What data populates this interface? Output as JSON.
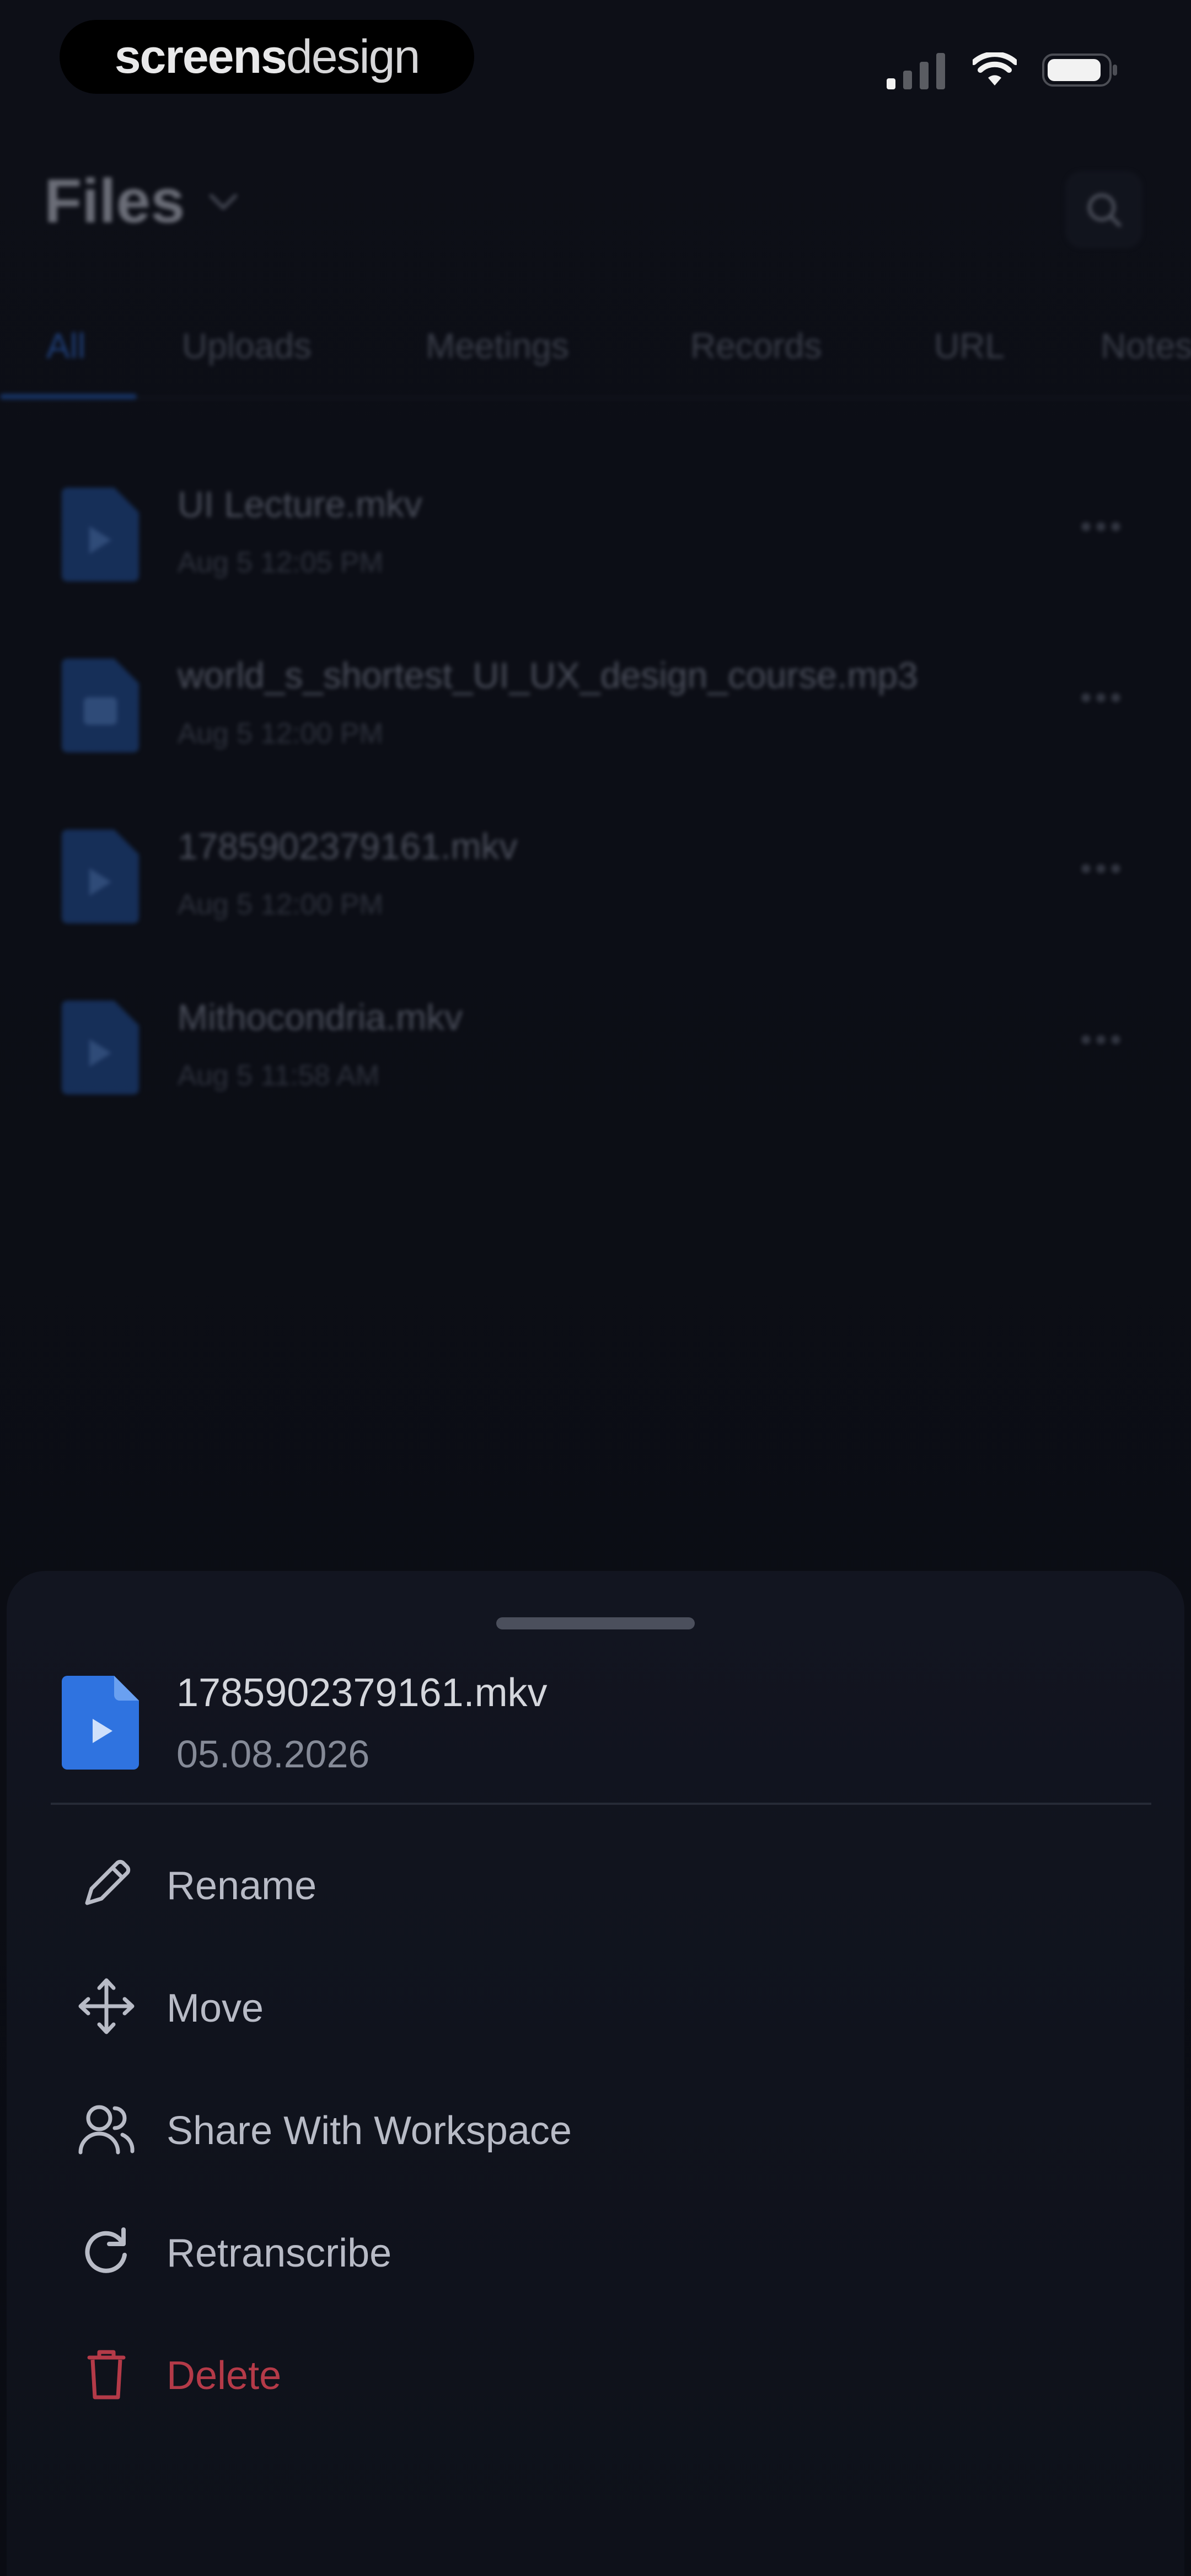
{
  "status_bar": {
    "brand_bold": "screens",
    "brand_light": "design"
  },
  "header": {
    "title": "Files"
  },
  "tabs": [
    {
      "label": "All",
      "active": true
    },
    {
      "label": "Uploads",
      "active": false
    },
    {
      "label": "Meetings",
      "active": false
    },
    {
      "label": "Records",
      "active": false
    },
    {
      "label": "URL",
      "active": false
    },
    {
      "label": "Notes",
      "active": false
    }
  ],
  "files": [
    {
      "name": "UI Lecture.mkv",
      "date": "Aug 5 12:05 PM"
    },
    {
      "name": "world_s_shortest_UI_UX_design_course.mp3",
      "date": "Aug 5 12:00 PM"
    },
    {
      "name": "1785902379161.mkv",
      "date": "Aug 5 12:00 PM"
    },
    {
      "name": "Mithocondria.mkv",
      "date": "Aug 5 11:58 AM"
    }
  ],
  "sheet": {
    "file_name": "1785902379161.mkv",
    "file_date": "05.08.2026",
    "actions": [
      {
        "id": "rename",
        "label": "Rename"
      },
      {
        "id": "move",
        "label": "Move"
      },
      {
        "id": "share",
        "label": "Share With Workspace"
      },
      {
        "id": "retranscribe",
        "label": "Retranscribe"
      },
      {
        "id": "delete",
        "label": "Delete"
      }
    ]
  },
  "colors": {
    "accent": "#2d64c4",
    "danger": "#b43a48",
    "sheet_bg": "#121520"
  }
}
